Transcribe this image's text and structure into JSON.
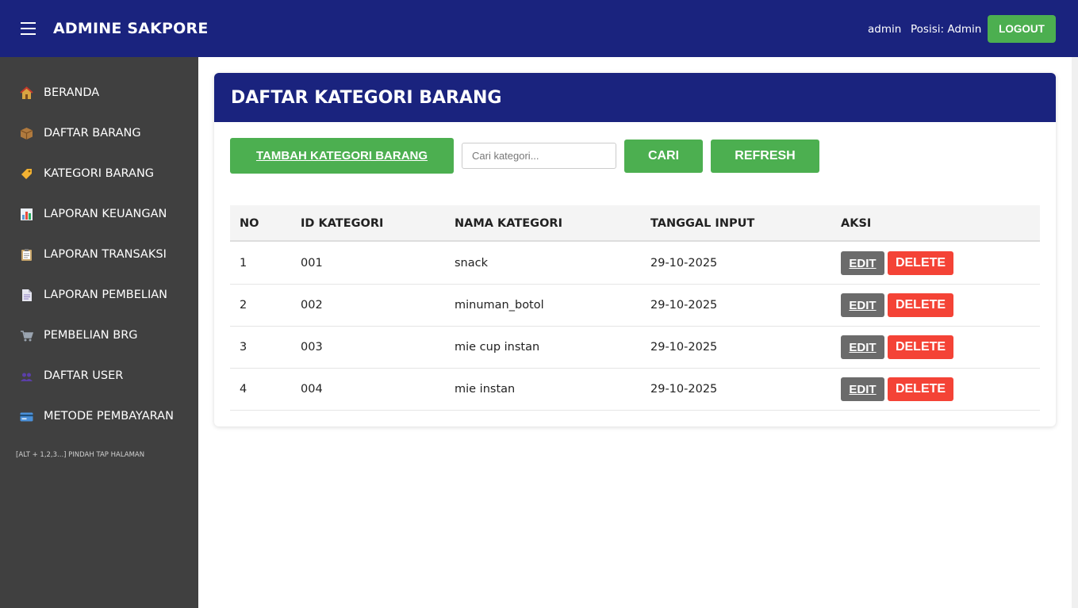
{
  "header": {
    "brand": "ADMINE SAKPORE",
    "user_name": "admin",
    "user_role": "Posisi: Admin",
    "logout_label": "LOGOUT"
  },
  "sidebar": {
    "items": [
      {
        "label": "BERANDA",
        "icon": "house-icon",
        "icon_color": "#d9a441"
      },
      {
        "label": "DAFTAR BARANG",
        "icon": "package-icon",
        "icon_color": "#b07a3e"
      },
      {
        "label": "KATEGORI BARANG",
        "icon": "tag-icon",
        "icon_color": "#f2b233"
      },
      {
        "label": "LAPORAN KEUANGAN",
        "icon": "bar-chart-icon",
        "icon_color": "#5b9bd5"
      },
      {
        "label": "LAPORAN TRANSAKSI",
        "icon": "clipboard-icon",
        "icon_color": "#c9a66b"
      },
      {
        "label": "LAPORAN PEMBELIAN",
        "icon": "document-icon",
        "icon_color": "#e6e6f0"
      },
      {
        "label": "PEMBELIAN BRG",
        "icon": "cart-icon",
        "icon_color": "#9aa4b0"
      },
      {
        "label": "DAFTAR USER",
        "icon": "users-icon",
        "icon_color": "#5b3fa8"
      },
      {
        "label": "METODE PEMBAYARAN",
        "icon": "credit-card-icon",
        "icon_color": "#4a90d9"
      }
    ],
    "hint": "[ALT + 1,2,3...] PINDAH TAP HALAMAN"
  },
  "main": {
    "title": "DAFTAR KATEGORI BARANG",
    "add_label": "TAMBAH KATEGORI BARANG",
    "search_placeholder": "Cari kategori...",
    "search_value": "",
    "search_button": "CARI",
    "refresh_button": "REFRESH",
    "table": {
      "columns": [
        "NO",
        "ID KATEGORI",
        "NAMA KATEGORI",
        "TANGGAL INPUT",
        "AKSI"
      ],
      "rows": [
        {
          "no": "1",
          "id": "001",
          "name": "snack",
          "date": "29-10-2025",
          "edit": "EDIT",
          "delete": "DELETE"
        },
        {
          "no": "2",
          "id": "002",
          "name": "minuman_botol",
          "date": "29-10-2025",
          "edit": "EDIT",
          "delete": "DELETE"
        },
        {
          "no": "3",
          "id": "003",
          "name": "mie cup instan",
          "date": "29-10-2025",
          "edit": "EDIT",
          "delete": "DELETE"
        },
        {
          "no": "4",
          "id": "004",
          "name": "mie instan",
          "date": "29-10-2025",
          "edit": "EDIT",
          "delete": "DELETE"
        }
      ]
    }
  },
  "colors": {
    "navy": "#1a237e",
    "green": "#4caf50",
    "red": "#f44336",
    "sidebar_bg": "#404040",
    "edit_gray": "#6b6b6b"
  }
}
